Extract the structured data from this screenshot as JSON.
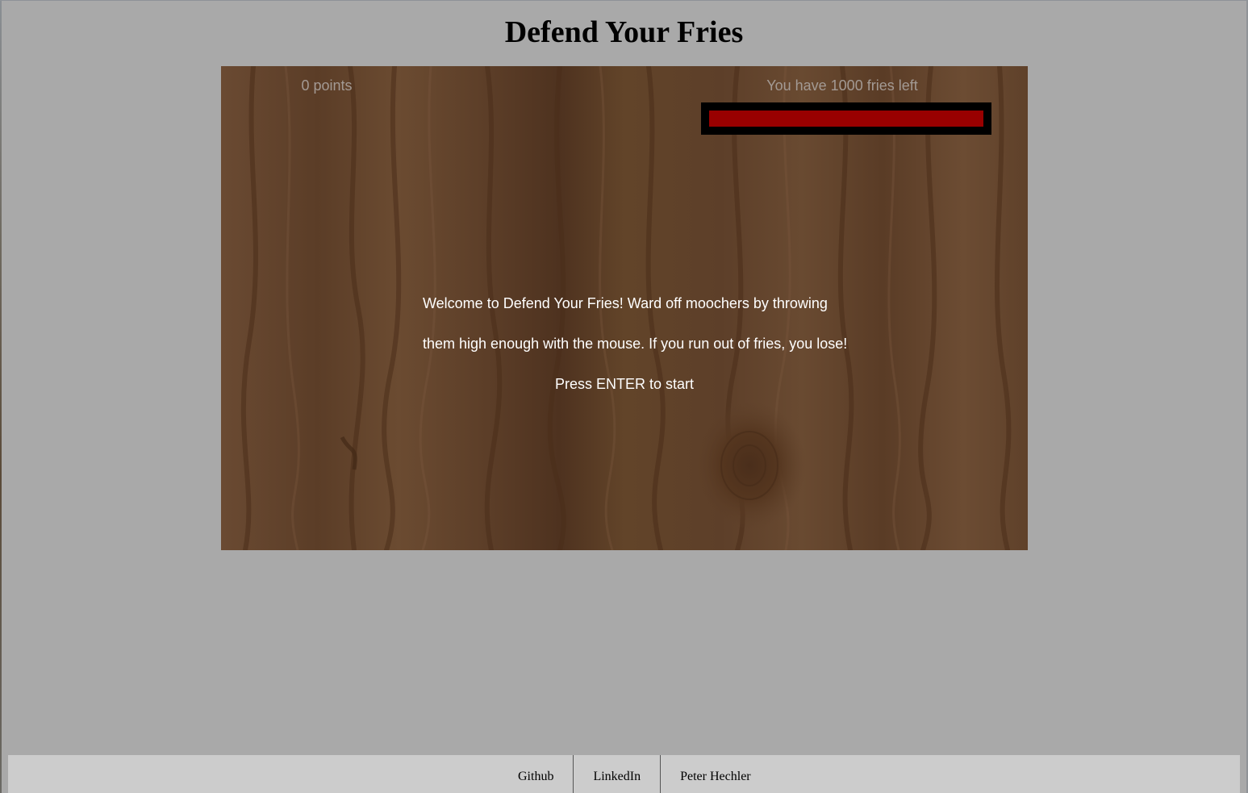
{
  "page": {
    "title": "Defend Your Fries"
  },
  "game": {
    "score_text": "0 points",
    "fries_text": "You have 1000 fries left",
    "fries_remaining": 1000,
    "health_fraction": 1.0,
    "welcome_line_1": "Welcome to Defend Your Fries! Ward off moochers by throwing",
    "welcome_line_2": "them high enough with the mouse. If you run out of fries, you lose!",
    "start_prompt": "Press ENTER to start"
  },
  "footer": {
    "links": [
      {
        "label": "Github"
      },
      {
        "label": "LinkedIn"
      },
      {
        "label": "Peter Hechler"
      }
    ]
  },
  "colors": {
    "page_background": "#a9a9a9",
    "wood_base": "#5e4029",
    "wood_dark": "#4a2f1c",
    "wood_light": "#6e4d33",
    "health_bar_border": "#000000",
    "health_bar_fill": "#990000",
    "hud_text": "#a39a94",
    "message_text": "#ffffff",
    "footer_background": "#cccccc"
  }
}
